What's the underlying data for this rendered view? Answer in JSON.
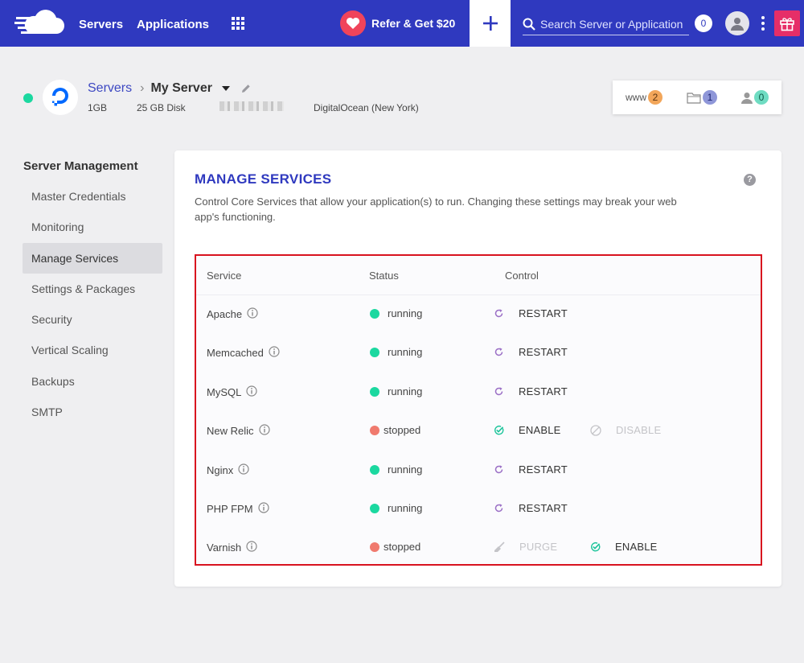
{
  "topbar": {
    "nav": [
      "Servers",
      "Applications"
    ],
    "refer_label": "Refer & Get $20",
    "search_placeholder": "Search Server or Application",
    "notifications_count": "0",
    "colors": {
      "bar": "#2f39bf",
      "refer": "#f0445b",
      "gift": "#e62e68"
    }
  },
  "server": {
    "breadcrumb_root": "Servers",
    "name": "My Server",
    "ram": "1GB",
    "disk": "25 GB Disk",
    "provider": "DigitalOcean (New York)",
    "status_color": "#1bd8a0",
    "counters": [
      {
        "label": "www",
        "value": "2",
        "icon": "www-icon",
        "color": "#f2a65a"
      },
      {
        "label": "",
        "value": "1",
        "icon": "folder-icon",
        "color": "#8e96d8"
      },
      {
        "label": "",
        "value": "0",
        "icon": "user-icon",
        "color": "#6fdcc2"
      }
    ]
  },
  "sidebar": {
    "title": "Server Management",
    "items": [
      {
        "label": "Master Credentials",
        "active": false
      },
      {
        "label": "Monitoring",
        "active": false
      },
      {
        "label": "Manage Services",
        "active": true
      },
      {
        "label": "Settings & Packages",
        "active": false
      },
      {
        "label": "Security",
        "active": false
      },
      {
        "label": "Vertical Scaling",
        "active": false
      },
      {
        "label": "Backups",
        "active": false
      },
      {
        "label": "SMTP",
        "active": false
      }
    ]
  },
  "main": {
    "title": "MANAGE SERVICES",
    "help_label": "?",
    "description": "Control Core Services that allow your application(s) to run. Changing these settings may break your web app's functioning.",
    "columns": [
      "Service",
      "Status",
      "Control"
    ],
    "services": [
      {
        "name": "Apache",
        "status": "running",
        "controls": [
          {
            "label": "RESTART",
            "icon": "restart-icon",
            "enabled": true
          }
        ]
      },
      {
        "name": "Memcached",
        "status": "running",
        "controls": [
          {
            "label": "RESTART",
            "icon": "restart-icon",
            "enabled": true
          }
        ]
      },
      {
        "name": "MySQL",
        "status": "running",
        "controls": [
          {
            "label": "RESTART",
            "icon": "restart-icon",
            "enabled": true
          }
        ]
      },
      {
        "name": "New Relic",
        "status": "stopped",
        "controls": [
          {
            "label": "ENABLE",
            "icon": "check-circle-icon",
            "enabled": true
          },
          {
            "label": "DISABLE",
            "icon": "ban-icon",
            "enabled": false
          }
        ]
      },
      {
        "name": "Nginx",
        "status": "running",
        "controls": [
          {
            "label": "RESTART",
            "icon": "restart-icon",
            "enabled": true
          }
        ]
      },
      {
        "name": "PHP FPM",
        "status": "running",
        "controls": [
          {
            "label": "RESTART",
            "icon": "restart-icon",
            "enabled": true
          }
        ]
      },
      {
        "name": "Varnish",
        "status": "stopped",
        "controls": [
          {
            "label": "PURGE",
            "icon": "broom-icon",
            "enabled": false
          },
          {
            "label": "ENABLE",
            "icon": "check-circle-icon",
            "enabled": true
          }
        ]
      }
    ]
  }
}
